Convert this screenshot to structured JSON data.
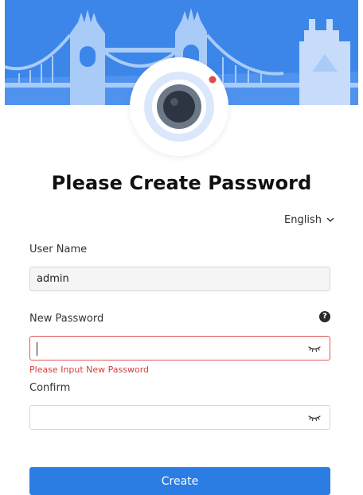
{
  "title": "Please Create Password",
  "language": {
    "selected": "English"
  },
  "fields": {
    "username": {
      "label": "User Name",
      "value": "admin"
    },
    "new_password": {
      "label": "New Password",
      "value": "",
      "error": "Please Input New Password"
    },
    "confirm": {
      "label": "Confirm",
      "value": ""
    }
  },
  "actions": {
    "create_label": "Create"
  },
  "icons": {
    "help": "question-circle-icon",
    "password_toggle": "eye-closed-icon",
    "language_dropdown": "chevron-down-icon",
    "logo": "camera-icon"
  },
  "colors": {
    "banner_background": "#3c86ea",
    "primary_button": "#2b7de3",
    "error": "#d63c3c",
    "input_border_error": "#e25a5a"
  }
}
